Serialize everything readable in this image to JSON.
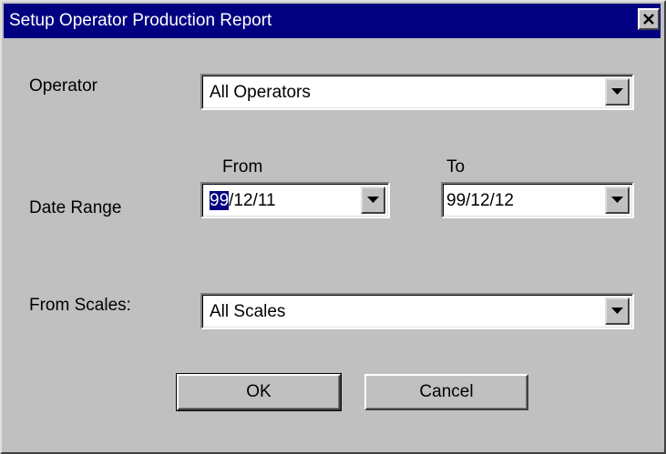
{
  "window": {
    "title": "Setup Operator Production Report"
  },
  "operator": {
    "label": "Operator",
    "value": "All Operators"
  },
  "date_range": {
    "label": "Date Range",
    "from_label": "From",
    "to_label": "To",
    "from_selected": "99",
    "from_rest": "/12/11",
    "to_value": "99/12/12"
  },
  "scales": {
    "label": "From Scales:",
    "value": "All Scales"
  },
  "buttons": {
    "ok": "OK",
    "cancel": "Cancel"
  },
  "icons": {
    "close": "close-icon",
    "dropdown": "chevron-down-icon"
  },
  "colors": {
    "titlebar": "#000080",
    "face": "#c0c0c0",
    "selection": "#000080"
  }
}
